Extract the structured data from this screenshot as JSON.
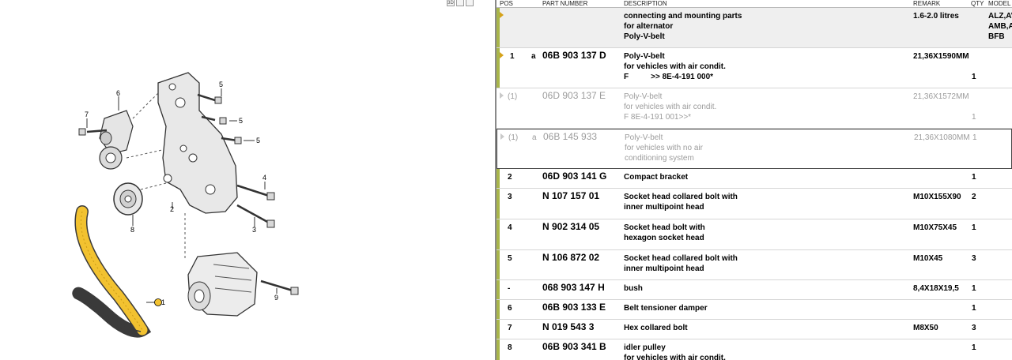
{
  "diagram": {
    "view_buttons": [
      "3D",
      "",
      ""
    ],
    "callouts": {
      "c1": "1",
      "c2": "2",
      "c3": "3",
      "c4": "4",
      "c5a": "5",
      "c5b": "5",
      "c5c": "5",
      "c6": "6",
      "c7": "7",
      "c8": "8",
      "c9": "9"
    }
  },
  "table": {
    "headers": {
      "pos": "POS",
      "part_number": "PART NUMBER",
      "description": "DESCRIPTION",
      "remark": "REMARK",
      "qty": "QTY",
      "model": "MODEL"
    },
    "rows": [
      {
        "pos": "",
        "variant": "",
        "part_number": "",
        "desc1": "connecting and mounting parts",
        "desc2": "for alternator",
        "desc3": "Poly-V-belt",
        "remark": "1.6-2.0 litres",
        "qty": "",
        "model1": "ALZ,AV",
        "model2": "AMB,A",
        "model3": "BFB"
      },
      {
        "pos": "1",
        "variant": "a",
        "part_number": "06B 903 137 D",
        "desc1": "Poly-V-belt",
        "desc2": "for vehicles with air condit.",
        "desc3a": "F",
        "desc3b": ">> 8E-4-191 000*",
        "remark": "21,36X1590MM",
        "qty": "1"
      },
      {
        "pos": "(1)",
        "variant": "",
        "part_number": "06D 903 137 E",
        "desc1": "Poly-V-belt",
        "desc2": "for vehicles with air condit.",
        "desc3": "F 8E-4-191 001>>*",
        "remark": "21,36X1572MM",
        "qty": "1"
      },
      {
        "pos": "(1)",
        "variant": "a",
        "part_number": "06B 145 933",
        "desc1": "Poly-V-belt",
        "desc2": "for vehicles with no air",
        "desc3": "conditioning system",
        "remark": "21,36X1080MM",
        "qty": "1"
      },
      {
        "pos": "2",
        "variant": "",
        "part_number": "06D 903 141 G",
        "desc1": "Compact bracket",
        "remark": "",
        "qty": "1"
      },
      {
        "pos": "3",
        "variant": "",
        "part_number": "N  107 157 01",
        "desc1": "Socket head collared bolt with",
        "desc2": "inner multipoint head",
        "remark": "M10X155X90",
        "qty": "2"
      },
      {
        "pos": "4",
        "variant": "",
        "part_number": "N  902 314 05",
        "desc1": "Socket head bolt with",
        "desc2": "hexagon socket head",
        "remark": "M10X75X45",
        "qty": "1"
      },
      {
        "pos": "5",
        "variant": "",
        "part_number": "N  106 872 02",
        "desc1": "Socket head collared bolt with",
        "desc2": "inner multipoint head",
        "remark": "M10X45",
        "qty": "3"
      },
      {
        "pos": "-",
        "variant": "",
        "part_number": "068 903 147 H",
        "desc1": "bush",
        "remark": "8,4X18X19,5",
        "qty": "1"
      },
      {
        "pos": "6",
        "variant": "",
        "part_number": "06B 903 133 E",
        "desc1": "Belt tensioner damper",
        "remark": "",
        "qty": "1"
      },
      {
        "pos": "7",
        "variant": "",
        "part_number": "N  019 543 3",
        "desc1": "Hex collared bolt",
        "remark": "M8X50",
        "qty": "3"
      },
      {
        "pos": "8",
        "variant": "",
        "part_number": "06B 903 341 B",
        "desc1": "idler pulley",
        "desc2": "for vehicles with air condit.",
        "remark": "",
        "qty": "1"
      }
    ]
  },
  "colors": {
    "accent_bar": "#a8b54a",
    "arrow": "#d5a21b",
    "belt": "#f2c230"
  },
  "icons": {
    "row_arrow": "triangle-right-icon"
  }
}
